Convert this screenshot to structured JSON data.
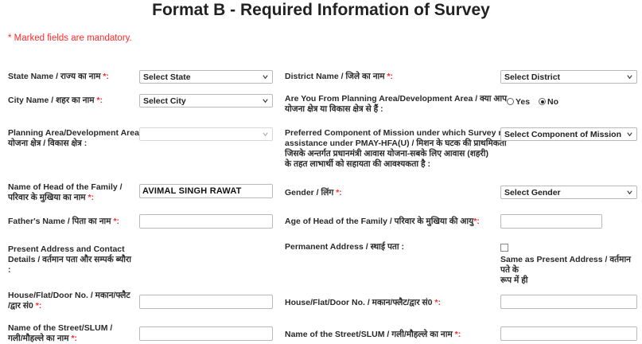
{
  "title": "Format B - Required Information of Survey",
  "mandatory_note": "* Marked fields are mandatory.",
  "fields": {
    "state": {
      "label": "State Name / राज्य का नाम ",
      "value": "Select State"
    },
    "district": {
      "label": "District Name / जिले का नाम ",
      "value": "Select District"
    },
    "city": {
      "label": "City Name / शहर का नाम ",
      "value": "Select City"
    },
    "planning_question": {
      "label_1": "Are You From Planning Area/Development Area / क्या आप",
      "label_2": "योजना क्षेत्र या विकास क्षेत्र से हैं :"
    },
    "radio_yes": "Yes",
    "radio_no": "No",
    "planning_area": {
      "label_1": "Planning Area/Development Area /",
      "label_2": "योजना क्षेत्र / विकास क्षेत्र :",
      "value": ""
    },
    "component": {
      "label_1": "Preferred Component of Mission under which Survey need",
      "label_2": "assistance under PMAY-HFA(U) / मिशन के घटक की प्राथमिकता",
      "label_3": "जिसके अन्तर्गत प्रधानमंत्री आवास योजना-सबके लिए आवास (शहरी)",
      "label_4": "के तहत लाभार्थी को सहायता की आवश्यकता है :",
      "value": "Select Component of Mission"
    },
    "head_name": {
      "label_1": "Name of Head of the Family /",
      "label_2": "परिवार के मुखिया का नाम ",
      "value": "AVIMAL SINGH RAWAT"
    },
    "gender": {
      "label": "Gender / लिंग ",
      "value": "Select Gender"
    },
    "father_name": {
      "label": "Father's Name / पिता का नाम ",
      "value": ""
    },
    "age": {
      "label": "Age of Head of the Family / परिवार के मुखिया की आयु",
      "value": ""
    },
    "present_address": {
      "label_1": "Present Address and Contact",
      "label_2": "Details / वर्तमान पता और सम्पर्क ब्यौरा",
      "label_3": ":"
    },
    "permanent_address": {
      "label": "Permanent Address / स्थाई पता :"
    },
    "same_as": {
      "label_1": "Same as Present Address / वर्तमान पते के",
      "label_2": "रूप में ही"
    },
    "house_no_left": {
      "label_1": "House/Flat/Door No. / मकान/फ्लैट",
      "label_2": "/द्वार सं0 ",
      "value": ""
    },
    "house_no_right": {
      "label": "House/Flat/Door No. / मकान/फ्लैट/द्वार सं0 ",
      "value": ""
    },
    "street_left": {
      "label_1": "Name of the Street/SLUM /",
      "label_2": "गली/मौहल्ले का नाम ",
      "value": ""
    },
    "street_right": {
      "label": "Name of the Street/SLUM / गली/मौहल्ले का नाम ",
      "value": ""
    },
    "required_mark": "*:",
    "required_mark_right": "*:"
  }
}
